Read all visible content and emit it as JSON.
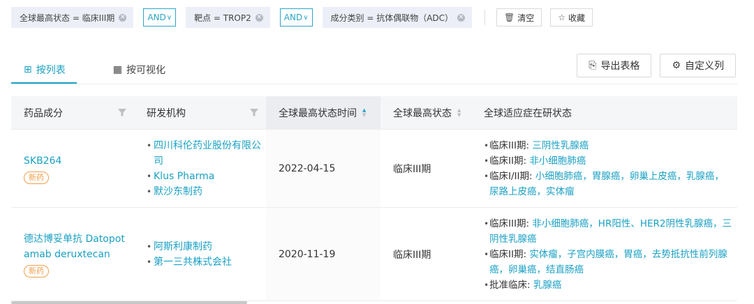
{
  "filters": {
    "chips": [
      {
        "label": "全球最高状态 = 临床III期"
      },
      {
        "label": "靶点 = TROP2"
      },
      {
        "label": "成分类别 = 抗体偶联物（ADC）"
      }
    ],
    "operators": [
      "AND",
      "AND"
    ],
    "clear_label": "清空",
    "favorite_label": "收藏"
  },
  "tabs": [
    {
      "label": "按列表",
      "icon": "table-icon",
      "active": true
    },
    {
      "label": "按可视化",
      "icon": "grid-icon",
      "active": false
    }
  ],
  "actions": {
    "export_label": "导出表格",
    "custom_columns_label": "自定义列"
  },
  "table": {
    "headers": [
      "药品成分",
      "研发机构",
      "全球最高状态时间",
      "全球最高状态",
      "全球适应症在研状态"
    ],
    "rows": [
      {
        "drug": "SKB264",
        "tag": "新药",
        "orgs": [
          "四川科伦药业股份有限公司",
          "Klus Pharma",
          "默沙东制药"
        ],
        "date": "2022-04-15",
        "status": "临床III期",
        "indications": [
          {
            "label": "临床III期: ",
            "values": "三阴性乳腺癌"
          },
          {
            "label": "临床II期: ",
            "values": "非小细胞肺癌"
          },
          {
            "label": "临床I/II期: ",
            "values": "小细胞肺癌，胃腺癌，卵巢上皮癌，乳腺癌，尿路上皮癌，实体瘤"
          }
        ]
      },
      {
        "drug": "德达博妥单抗 Datopotamab deruxtecan",
        "tag": "新药",
        "orgs": [
          "阿斯利康制药",
          "第一三共株式会社"
        ],
        "date": "2020-11-19",
        "status": "临床III期",
        "indications": [
          {
            "label": "临床III期: ",
            "values": "非小细胞肺癌，HR阳性、HER2阴性乳腺癌，三阴性乳腺癌"
          },
          {
            "label": "临床II期: ",
            "values": "实体瘤，子宫内膜癌，胃癌，去势抵抗性前列腺癌，卵巢癌，结直肠癌"
          },
          {
            "label": "批准临床: ",
            "values": "乳腺癌"
          }
        ]
      }
    ]
  }
}
